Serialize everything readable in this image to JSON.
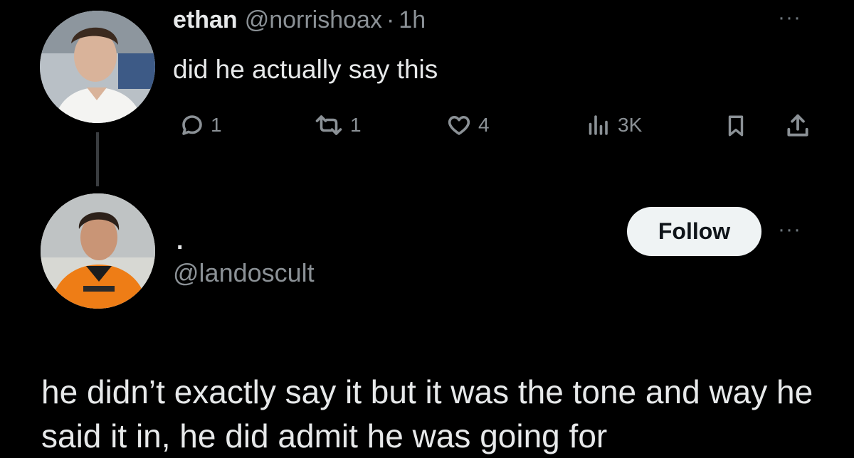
{
  "tweet1": {
    "display_name": "ethan",
    "handle": "@norrishoax",
    "separator": "·",
    "time": "1h",
    "text": "did he actually say this",
    "more_icon": "···",
    "actions": {
      "reply_count": "1",
      "retweet_count": "1",
      "like_count": "4",
      "views_count": "3K"
    }
  },
  "tweet2": {
    "display_name": ".",
    "handle": "@landoscult",
    "follow_label": "Follow",
    "more_icon": "···",
    "text": "he didn’t exactly say it but it was the tone and way he said it in, he did admit he was going for"
  },
  "colors": {
    "background": "#000000",
    "text": "#e7e9ea",
    "muted": "#8b9196",
    "follow_bg": "#eff3f4"
  },
  "icons": [
    "reply-icon",
    "retweet-icon",
    "like-icon",
    "views-icon",
    "bookmark-icon",
    "share-icon",
    "more-icon"
  ]
}
